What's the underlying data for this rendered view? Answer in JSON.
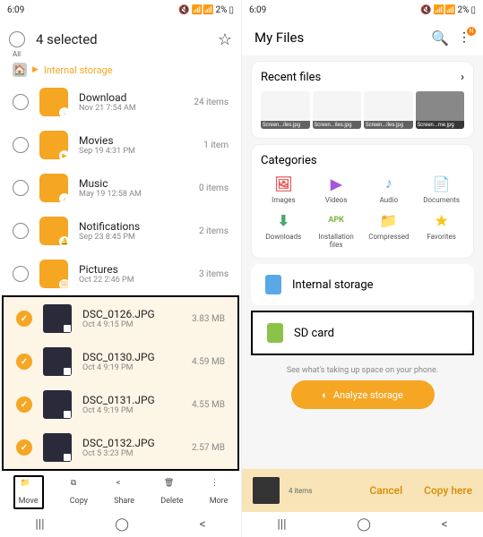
{
  "status": {
    "time": "6:09",
    "battery": "2%",
    "icons": "🔇 📶 📶"
  },
  "left": {
    "title": "4 selected",
    "all": "All",
    "crumb": "Internal storage",
    "folders": [
      {
        "name": "Download",
        "date": "Nov 21 7:54 AM",
        "meta": "24 items",
        "badge": "↓"
      },
      {
        "name": "Movies",
        "date": "Sep 19 4:31 PM",
        "meta": "1 item",
        "badge": "▶"
      },
      {
        "name": "Music",
        "date": "May 19 12:58 AM",
        "meta": "0 items",
        "badge": "♪"
      },
      {
        "name": "Notifications",
        "date": "Sep 23 8:45 PM",
        "meta": "2 items",
        "badge": "🔔"
      },
      {
        "name": "Pictures",
        "date": "Oct 22 2:46 PM",
        "meta": "3 items",
        "badge": "🖼"
      }
    ],
    "files": [
      {
        "name": "DSC_0126.JPG",
        "date": "Oct 4 9:15 PM",
        "meta": "3.83 MB"
      },
      {
        "name": "DSC_0130.JPG",
        "date": "Oct 4 9:19 PM",
        "meta": "4.59 MB"
      },
      {
        "name": "DSC_0131.JPG",
        "date": "Oct 4 9:19 PM",
        "meta": "4.55 MB"
      },
      {
        "name": "DSC_0132.JPG",
        "date": "Oct 5 3:23 PM",
        "meta": "2.57 MB"
      }
    ],
    "actions": {
      "move": "Move",
      "copy": "Copy",
      "share": "Share",
      "delete": "Delete",
      "more": "More"
    }
  },
  "right": {
    "title": "My Files",
    "badge": "N",
    "recent": {
      "title": "Recent files",
      "thumbs": [
        "Screen...iles.jpg",
        "Screen...iles.jpg",
        "Screen...iles.jpg",
        "Screen...me.jpg"
      ]
    },
    "categories": {
      "title": "Categories",
      "items": [
        {
          "icon": "🖼",
          "label": "Images",
          "color": "#e85d5d"
        },
        {
          "icon": "▶",
          "label": "Videos",
          "color": "#a259d9"
        },
        {
          "icon": "♪",
          "label": "Audio",
          "color": "#5aa9e6"
        },
        {
          "icon": "📄",
          "label": "Documents",
          "color": "#f5a623"
        },
        {
          "icon": "⬇",
          "label": "Downloads",
          "color": "#4aa96c"
        },
        {
          "icon": "APK",
          "label": "Installation files",
          "color": "#7cb342"
        },
        {
          "icon": "📁",
          "label": "Compressed",
          "color": "#f5a623"
        },
        {
          "icon": "★",
          "label": "Favorites",
          "color": "#f5c518"
        }
      ]
    },
    "storage": {
      "internal": "Internal storage",
      "sd": "SD card"
    },
    "hint": "See what's taking up space on your phone.",
    "analyze": "Analyze storage",
    "copybar": {
      "count": "4 items",
      "cancel": "Cancel",
      "copy": "Copy here"
    }
  }
}
